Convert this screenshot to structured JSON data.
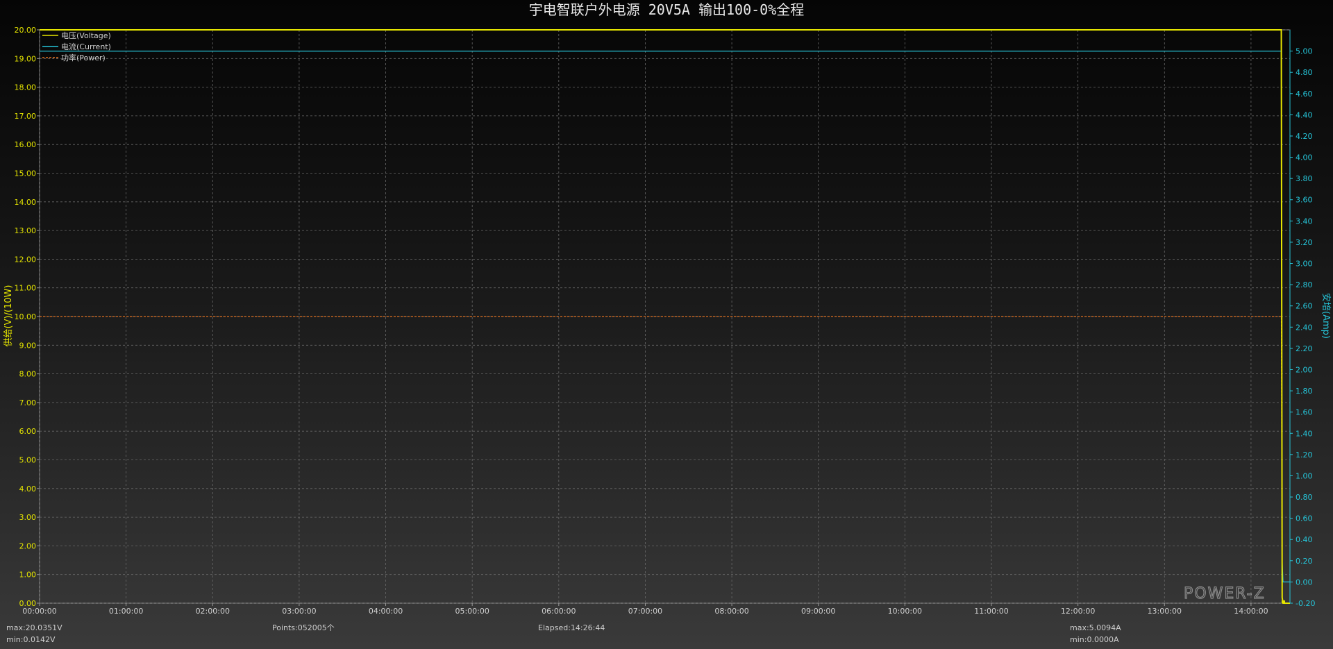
{
  "chart_data": {
    "type": "line",
    "title": "宇电智联户外电源 20V5A 输出100-0%全程",
    "ylabel_left": "供给(V)/(10W)",
    "ylabel_right": "安培(Amp)",
    "x_ticks": [
      "00:00:00",
      "01:00:00",
      "02:00:00",
      "03:00:00",
      "04:00:00",
      "05:00:00",
      "06:00:00",
      "07:00:00",
      "08:00:00",
      "09:00:00",
      "10:00:00",
      "11:00:00",
      "12:00:00",
      "13:00:00",
      "14:00:00"
    ],
    "x_hours_range": [
      0,
      14.45
    ],
    "ylim_left": [
      0,
      20
    ],
    "y_ticks_left": [
      "0.00",
      "1.00",
      "2.00",
      "3.00",
      "4.00",
      "5.00",
      "6.00",
      "7.00",
      "8.00",
      "9.00",
      "10.00",
      "11.00",
      "12.00",
      "13.00",
      "14.00",
      "15.00",
      "16.00",
      "17.00",
      "18.00",
      "19.00",
      "20.00"
    ],
    "ylim_right": [
      -0.2,
      5.2
    ],
    "y_ticks_right": [
      "-0.20",
      "0.00",
      "0.20",
      "0.40",
      "0.60",
      "0.80",
      "1.00",
      "1.20",
      "1.40",
      "1.60",
      "1.80",
      "2.00",
      "2.20",
      "2.40",
      "2.60",
      "2.80",
      "3.00",
      "3.20",
      "3.40",
      "3.60",
      "3.80",
      "4.00",
      "4.20",
      "4.40",
      "4.60",
      "4.80",
      "5.00"
    ],
    "grid": true,
    "legend_position": "top-left",
    "series": [
      {
        "name": "电压(Voltage)",
        "axis": "left",
        "color": "#e6e600",
        "x": [
          0,
          14.35,
          14.36,
          14.37,
          14.45
        ],
        "y": [
          20.0,
          20.0,
          0.2,
          0.0,
          0.0
        ]
      },
      {
        "name": "电流(Current)",
        "axis": "right",
        "color": "#26c6da",
        "x": [
          0,
          14.35,
          14.36,
          14.37,
          14.45
        ],
        "y": [
          5.0,
          5.0,
          0.2,
          0.0,
          0.0
        ]
      },
      {
        "name": "功率(Power)",
        "axis": "left",
        "color": "#e07020",
        "dashed": true,
        "x": [
          0,
          14.35,
          14.36,
          14.37,
          14.45
        ],
        "y": [
          10.0,
          10.0,
          0.2,
          0.0,
          0.0
        ]
      }
    ]
  },
  "stats": {
    "v_max": "max:20.0351V",
    "v_min": "min:0.0142V",
    "points": "Points:052005个",
    "elapsed": "Elapsed:14:26:44",
    "a_max": "max:5.0094A",
    "a_min": "min:0.0000A"
  },
  "brand": {
    "logo_text": "POWER-Z"
  }
}
